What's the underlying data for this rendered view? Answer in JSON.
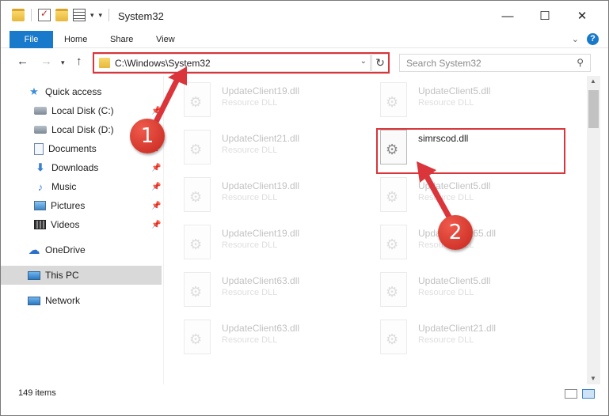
{
  "window": {
    "title": "System32"
  },
  "window_controls": {
    "minimize": "—",
    "maximize": "☐",
    "close": "✕"
  },
  "ribbon": {
    "tabs": [
      "File",
      "Home",
      "Share",
      "View"
    ],
    "help_label": "?"
  },
  "address": {
    "path": "C:\\Windows\\System32",
    "search_placeholder": "Search System32"
  },
  "sidebar": {
    "items": [
      {
        "label": "Quick access",
        "icon": "star-icon"
      },
      {
        "label": "Local Disk (C:)",
        "icon": "disk-icon",
        "pinned": true
      },
      {
        "label": "Local Disk (D:)",
        "icon": "disk-icon"
      },
      {
        "label": "Documents",
        "icon": "documents-icon",
        "pinned": true
      },
      {
        "label": "Downloads",
        "icon": "downloads-icon",
        "pinned": true
      },
      {
        "label": "Music",
        "icon": "music-icon",
        "pinned": true
      },
      {
        "label": "Pictures",
        "icon": "pictures-icon",
        "pinned": true
      },
      {
        "label": "Videos",
        "icon": "videos-icon",
        "pinned": true
      },
      {
        "label": "OneDrive",
        "icon": "onedrive-icon"
      },
      {
        "label": "This PC",
        "icon": "this-pc-icon",
        "selected": true
      },
      {
        "label": "Network",
        "icon": "network-icon"
      }
    ]
  },
  "files": [
    {
      "name": "UpdateClient19.dll",
      "type": "Resource DLL",
      "faded": true
    },
    {
      "name": "UpdateClient5.dll",
      "type": "Resource DLL",
      "faded": true
    },
    {
      "name": "UpdateClient21.dll",
      "type": "Resource DLL",
      "faded": true
    },
    {
      "name": "simrscod.dll",
      "type": "",
      "faded": false,
      "highlighted": true
    },
    {
      "name": "UpdateClient19.dll",
      "type": "Resource DLL",
      "faded": true
    },
    {
      "name": "UpdateClient5.dll",
      "type": "Resource DLL",
      "faded": true
    },
    {
      "name": "UpdateClient19.dll",
      "type": "Resource DLL",
      "faded": true
    },
    {
      "name": "UpdateClient65.dll",
      "type": "Resource DLL",
      "faded": true
    },
    {
      "name": "UpdateClient63.dll",
      "type": "Resource DLL",
      "faded": true
    },
    {
      "name": "UpdateClient5.dll",
      "type": "Resource DLL",
      "faded": true
    },
    {
      "name": "UpdateClient63.dll",
      "type": "Resource DLL",
      "faded": true
    },
    {
      "name": "UpdateClient21.dll",
      "type": "Resource DLL",
      "faded": true
    }
  ],
  "status": {
    "item_count": "149 items"
  },
  "callouts": [
    "1",
    "2"
  ],
  "colors": {
    "accent": "#1979ca",
    "callout": "#d9353b"
  }
}
